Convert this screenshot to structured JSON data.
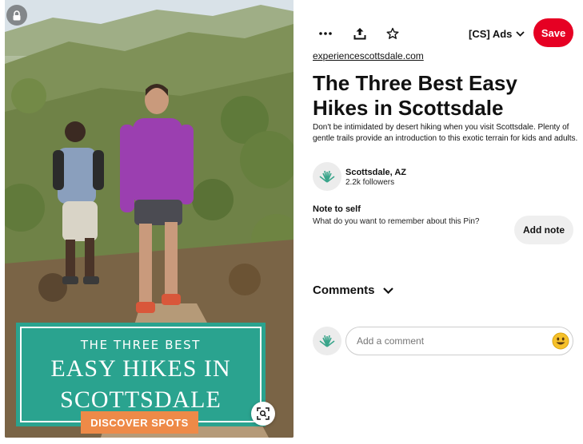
{
  "pin": {
    "overlay": {
      "kicker": "THE THREE BEST",
      "title_line1": "EASY HIKES IN",
      "title_line2": "SCOTTSDALE",
      "cta": "DISCOVER SPOTS"
    },
    "icons": {
      "lock": "lock-icon",
      "visual_search": "visual-search-icon"
    }
  },
  "toolbar": {
    "more_icon": "more-icon",
    "share_icon": "share-icon",
    "favorite_icon": "star-icon",
    "board": "[CS] Ads",
    "save_label": "Save"
  },
  "details": {
    "source": "experiencescottsdale.com",
    "title": "The Three Best Easy Hikes in Scottsdale",
    "description": "Don't be intimidated by desert hiking when you visit Scottsdale. Plenty of gentle trails provide an introduction to this exotic terrain for kids and adults."
  },
  "creator": {
    "name": "Scottsdale, AZ",
    "followers": "2.2k followers"
  },
  "note": {
    "title": "Note to self",
    "prompt": "What do you want to remember about this Pin?",
    "button": "Add note"
  },
  "comments": {
    "header": "Comments",
    "placeholder": "Add a comment"
  },
  "colors": {
    "save": "#e60023",
    "overlay": "#2aa38f",
    "cta": "#ee8a48"
  }
}
